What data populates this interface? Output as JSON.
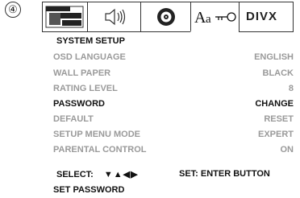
{
  "step_number": "④",
  "tabs": [
    {
      "name": "display-tab",
      "icon": "screen-layers-icon"
    },
    {
      "name": "audio-tab",
      "icon": "speaker-icon"
    },
    {
      "name": "disc-tab",
      "icon": "disc-icon"
    },
    {
      "name": "language-lock-tab",
      "icon": "language-key-icon",
      "label": "Aa"
    },
    {
      "name": "divx-tab",
      "label": "DIVX"
    }
  ],
  "menu": {
    "title": "SYSTEM SETUP",
    "rows": [
      {
        "label": "OSD LANGUAGE",
        "value": "ENGLISH",
        "highlight": false
      },
      {
        "label": "WALL PAPER",
        "value": "BLACK",
        "highlight": false
      },
      {
        "label": "RATING LEVEL",
        "value": "8",
        "highlight": false
      },
      {
        "label": "PASSWORD",
        "value": "CHANGE",
        "highlight": true
      },
      {
        "label": "DEFAULT",
        "value": "RESET",
        "highlight": false
      },
      {
        "label": "SETUP MENU MODE",
        "value": "EXPERT",
        "highlight": false
      },
      {
        "label": "PARENTAL CONTROL",
        "value": "ON",
        "highlight": false
      }
    ]
  },
  "footer": {
    "select_label": "SELECT:",
    "select_arrows": "▼▲◀▶",
    "set_label": "SET: ENTER BUTTON",
    "status": "SET PASSWORD"
  },
  "colors": {
    "dim_text": "#9a9a9a",
    "active_text": "#111111"
  }
}
